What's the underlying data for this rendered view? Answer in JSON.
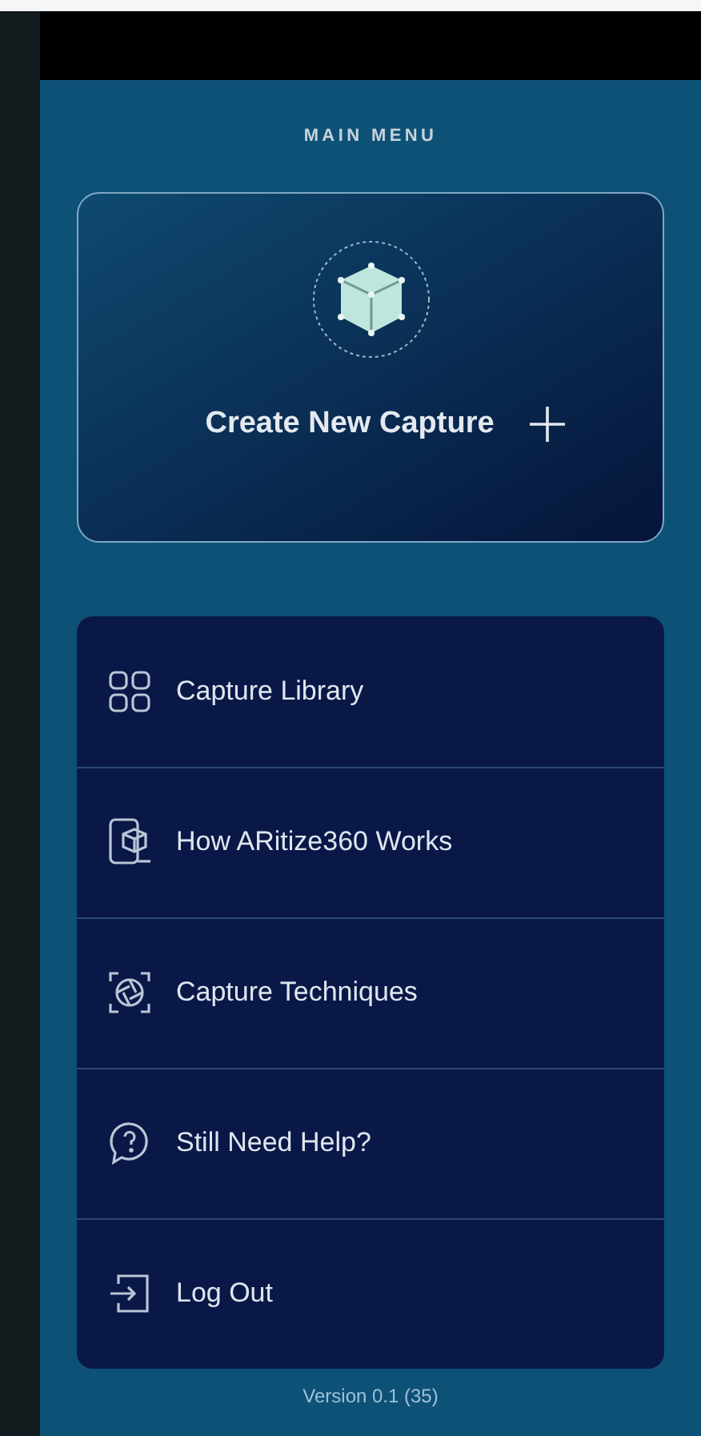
{
  "header": {
    "title": "MAIN MENU"
  },
  "create_card": {
    "label": "Create New Capture"
  },
  "menu_items": [
    {
      "kind": "library",
      "label": "Capture Library"
    },
    {
      "kind": "howto",
      "label": "How ARitize360 Works"
    },
    {
      "kind": "techniques",
      "label": "Capture Techniques"
    },
    {
      "kind": "help",
      "label": "Still Need Help?"
    },
    {
      "kind": "logout",
      "label": "Log Out"
    }
  ],
  "footer": {
    "version": "Version 0.1 (35)"
  }
}
